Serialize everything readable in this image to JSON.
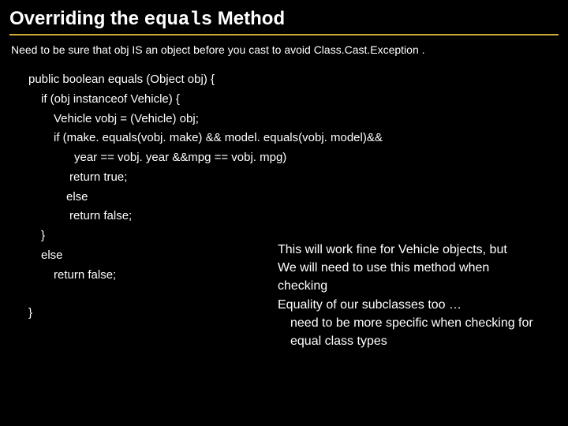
{
  "title_prefix": "Overriding the ",
  "title_mono": "equals",
  "title_suffix": " Method",
  "intro": "Need to be sure that obj IS an object before you cast to avoid Class.Cast.Exception .",
  "code": {
    "l0": "public boolean equals (Object obj) {",
    "l1": "if (obj instanceof Vehicle) {",
    "l2": "Vehicle vobj = (Vehicle) obj;",
    "l3": "if (make. equals(vobj. make) && model. equals(vobj. model)&&",
    "l4": "year == vobj. year &&mpg == vobj. mpg)",
    "l5": "return true;",
    "l6": "else",
    "l7": "return false;",
    "l8": "}",
    "l9": "else",
    "l10": "return false;",
    "l11": "}"
  },
  "note": {
    "n1": "This will work fine for Vehicle objects, but",
    "n2": "We will need to use this method when checking",
    "n3": "Equality of our subclasses too …",
    "n4": "need to be more specific when checking for",
    "n5": "equal class types"
  }
}
